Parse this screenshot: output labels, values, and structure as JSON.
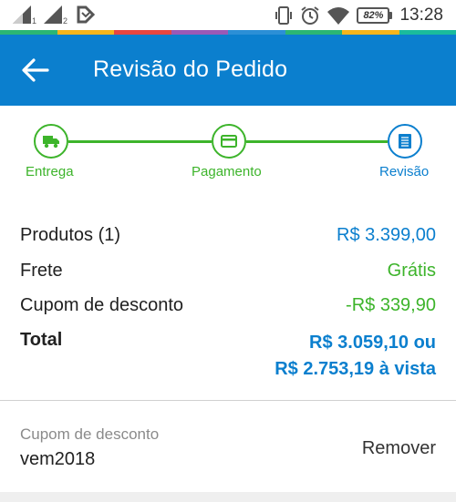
{
  "status_bar": {
    "sim1_label": "1",
    "sim2_label": "2",
    "battery_level": "82%",
    "time": "13:28",
    "icons": [
      "signal-icon",
      "signal-icon",
      "data-icon",
      "vibrate-icon",
      "alarm-icon",
      "wifi-icon",
      "battery-icon"
    ]
  },
  "colors": {
    "primary": "#0b7fce",
    "success": "#3db42b",
    "text": "#212121",
    "muted": "#8a8a8a"
  },
  "app_bar": {
    "title": "Revisão do Pedido",
    "back_icon": "arrow-back-icon"
  },
  "stepper": {
    "steps": [
      {
        "label": "Entrega",
        "icon": "truck-icon",
        "state": "completed"
      },
      {
        "label": "Pagamento",
        "icon": "credit-card-icon",
        "state": "completed"
      },
      {
        "label": "Revisão",
        "icon": "list-icon",
        "state": "current"
      }
    ]
  },
  "summary": {
    "products_label": "Produtos (1)",
    "products_value": "R$ 3.399,00",
    "shipping_label": "Frete",
    "shipping_value": "Grátis",
    "discount_label": "Cupom de desconto",
    "discount_value": "-R$ 339,90",
    "total_label": "Total",
    "total_installments": "R$ 3.059,10 ou",
    "total_cash": "R$ 2.753,19 à vista"
  },
  "coupon": {
    "caption": "Cupom de desconto",
    "code": "vem2018",
    "remove_label": "Remover"
  }
}
